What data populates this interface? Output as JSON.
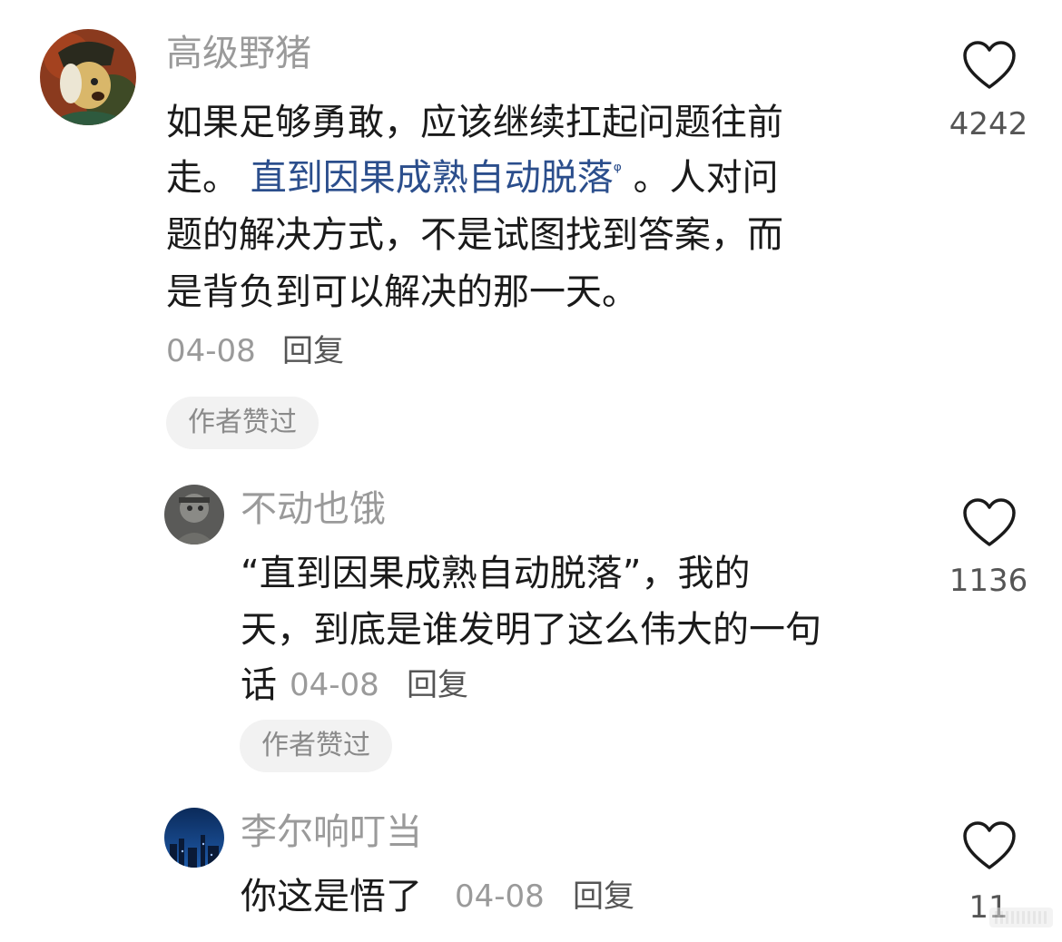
{
  "comments": [
    {
      "username": "高级野猪",
      "lines": [
        "如果足够勇敢，应该继续扛起问题往前",
        "。人对问",
        "题的解决方式，不是试图找到答案，而",
        "是背负到可以解决的那一天。"
      ],
      "line2_prefix": "走。",
      "line2_link": "直到因果成熟自动脱落",
      "date": "04-08",
      "reply": "回复",
      "badge": "作者赞过",
      "likes": "4242"
    },
    {
      "username": "不动也饿",
      "lines": [
        "“直到因果成熟自动脱落”，我的",
        "天，到底是谁发明了这么伟大的一句",
        "话"
      ],
      "date": "04-08",
      "reply": "回复",
      "badge": "作者赞过",
      "likes": "1136"
    },
    {
      "username": "李尔响叮当",
      "lines": [
        "你这是悟了"
      ],
      "date": "04-08",
      "reply": "回复",
      "likes": "11"
    }
  ],
  "colors": {
    "link": "#2b4e8c",
    "muted": "#9a9a9a",
    "badge_bg": "#f2f2f2"
  }
}
